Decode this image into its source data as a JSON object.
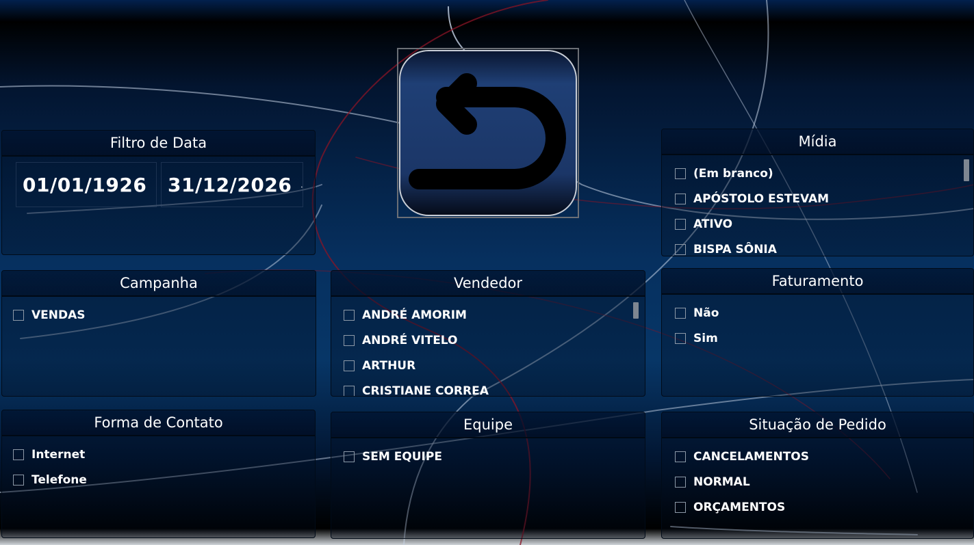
{
  "date_filter": {
    "title": "Filtro de Data",
    "start_date": "01/01/1926",
    "end_date": "31/12/2026"
  },
  "back_button": {
    "icon": "undo-arrow-icon"
  },
  "midia": {
    "title": "Mídia",
    "items": [
      "(Em branco)",
      "APÓSTOLO ESTEVAM",
      "ATIVO",
      "BISPA SÔNIA"
    ]
  },
  "campanha": {
    "title": "Campanha",
    "items": [
      "VENDAS"
    ]
  },
  "vendedor": {
    "title": "Vendedor",
    "items": [
      "ANDRÉ AMORIM",
      "ANDRÉ VITELO",
      "ARTHUR",
      "CRISTIANE CORREA"
    ]
  },
  "faturamento": {
    "title": "Faturamento",
    "items": [
      "Não",
      "Sim"
    ]
  },
  "forma_contato": {
    "title": "Forma de Contato",
    "items": [
      "Internet",
      "Telefone"
    ]
  },
  "equipe": {
    "title": "Equipe",
    "items": [
      "SEM EQUIPE"
    ]
  },
  "situacao_pedido": {
    "title": "Situação de Pedido",
    "items": [
      "CANCELAMENTOS",
      "NORMAL",
      "ORÇAMENTOS"
    ]
  },
  "colors": {
    "background_top": "#000000",
    "background_mid": "#06305f",
    "panel_header": "#001430",
    "button_fill": "#1d3b6e",
    "curve_red": "#8a1426",
    "curve_light": "#c7d3e6"
  }
}
